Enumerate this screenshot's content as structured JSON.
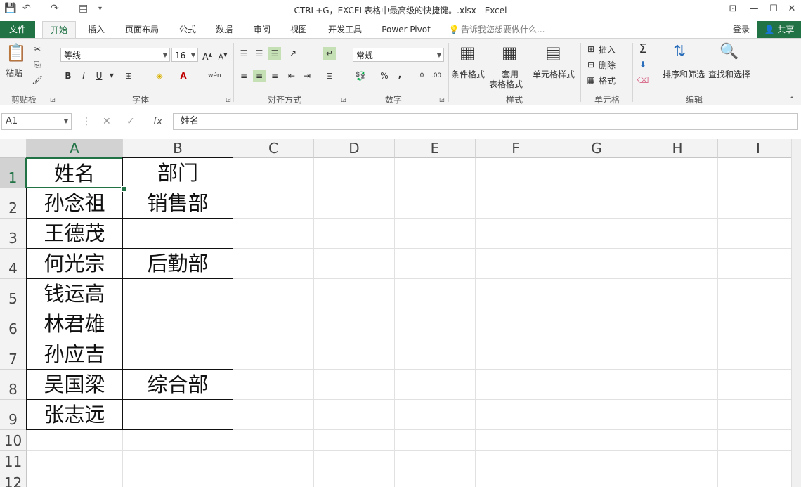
{
  "window": {
    "title": "CTRL+G，EXCEL表格中最高级的快捷键。.xlsx - Excel"
  },
  "tabs": {
    "file": "文件",
    "items": [
      "开始",
      "插入",
      "页面布局",
      "公式",
      "数据",
      "审阅",
      "视图",
      "开发工具",
      "Power Pivot"
    ],
    "tell_me": "告诉我您想要做什么...",
    "login": "登录",
    "share": "共享"
  },
  "ribbon": {
    "clipboard": {
      "paste": "粘贴",
      "label": "剪贴板"
    },
    "font": {
      "name": "等线",
      "size": "16",
      "label": "字体",
      "bold": "B",
      "italic": "I",
      "underline": "U"
    },
    "alignment": {
      "label": "对齐方式"
    },
    "number": {
      "format": "常规",
      "label": "数字",
      "percent": "%",
      "comma": ","
    },
    "styles": {
      "conditional": "条件格式",
      "table1": "套用",
      "table2": "表格格式",
      "cell": "单元格样式",
      "label": "样式"
    },
    "cells": {
      "insert": "插入",
      "delete": "删除",
      "format": "格式",
      "label": "单元格"
    },
    "editing": {
      "sort": "排序和筛选",
      "find": "查找和选择",
      "label": "编辑"
    }
  },
  "formula_bar": {
    "name_box": "A1",
    "fx": "fx",
    "value": "姓名"
  },
  "columns": [
    "A",
    "B",
    "C",
    "D",
    "E",
    "F",
    "G",
    "H",
    "I"
  ],
  "rows": [
    "1",
    "2",
    "3",
    "4",
    "5",
    "6",
    "7",
    "8",
    "9",
    "10",
    "11",
    "12"
  ],
  "cells": {
    "A": [
      "姓名",
      "孙念祖",
      "王德茂",
      "何光宗",
      "钱运高",
      "林君雄",
      "孙应吉",
      "吴国梁",
      "张志远"
    ],
    "B": [
      "部门",
      "销售部",
      "",
      "后勤部",
      "",
      "",
      "",
      "综合部",
      ""
    ]
  },
  "colors": {
    "accent": "#217346",
    "ribbon_bg": "#f3f3f3"
  }
}
